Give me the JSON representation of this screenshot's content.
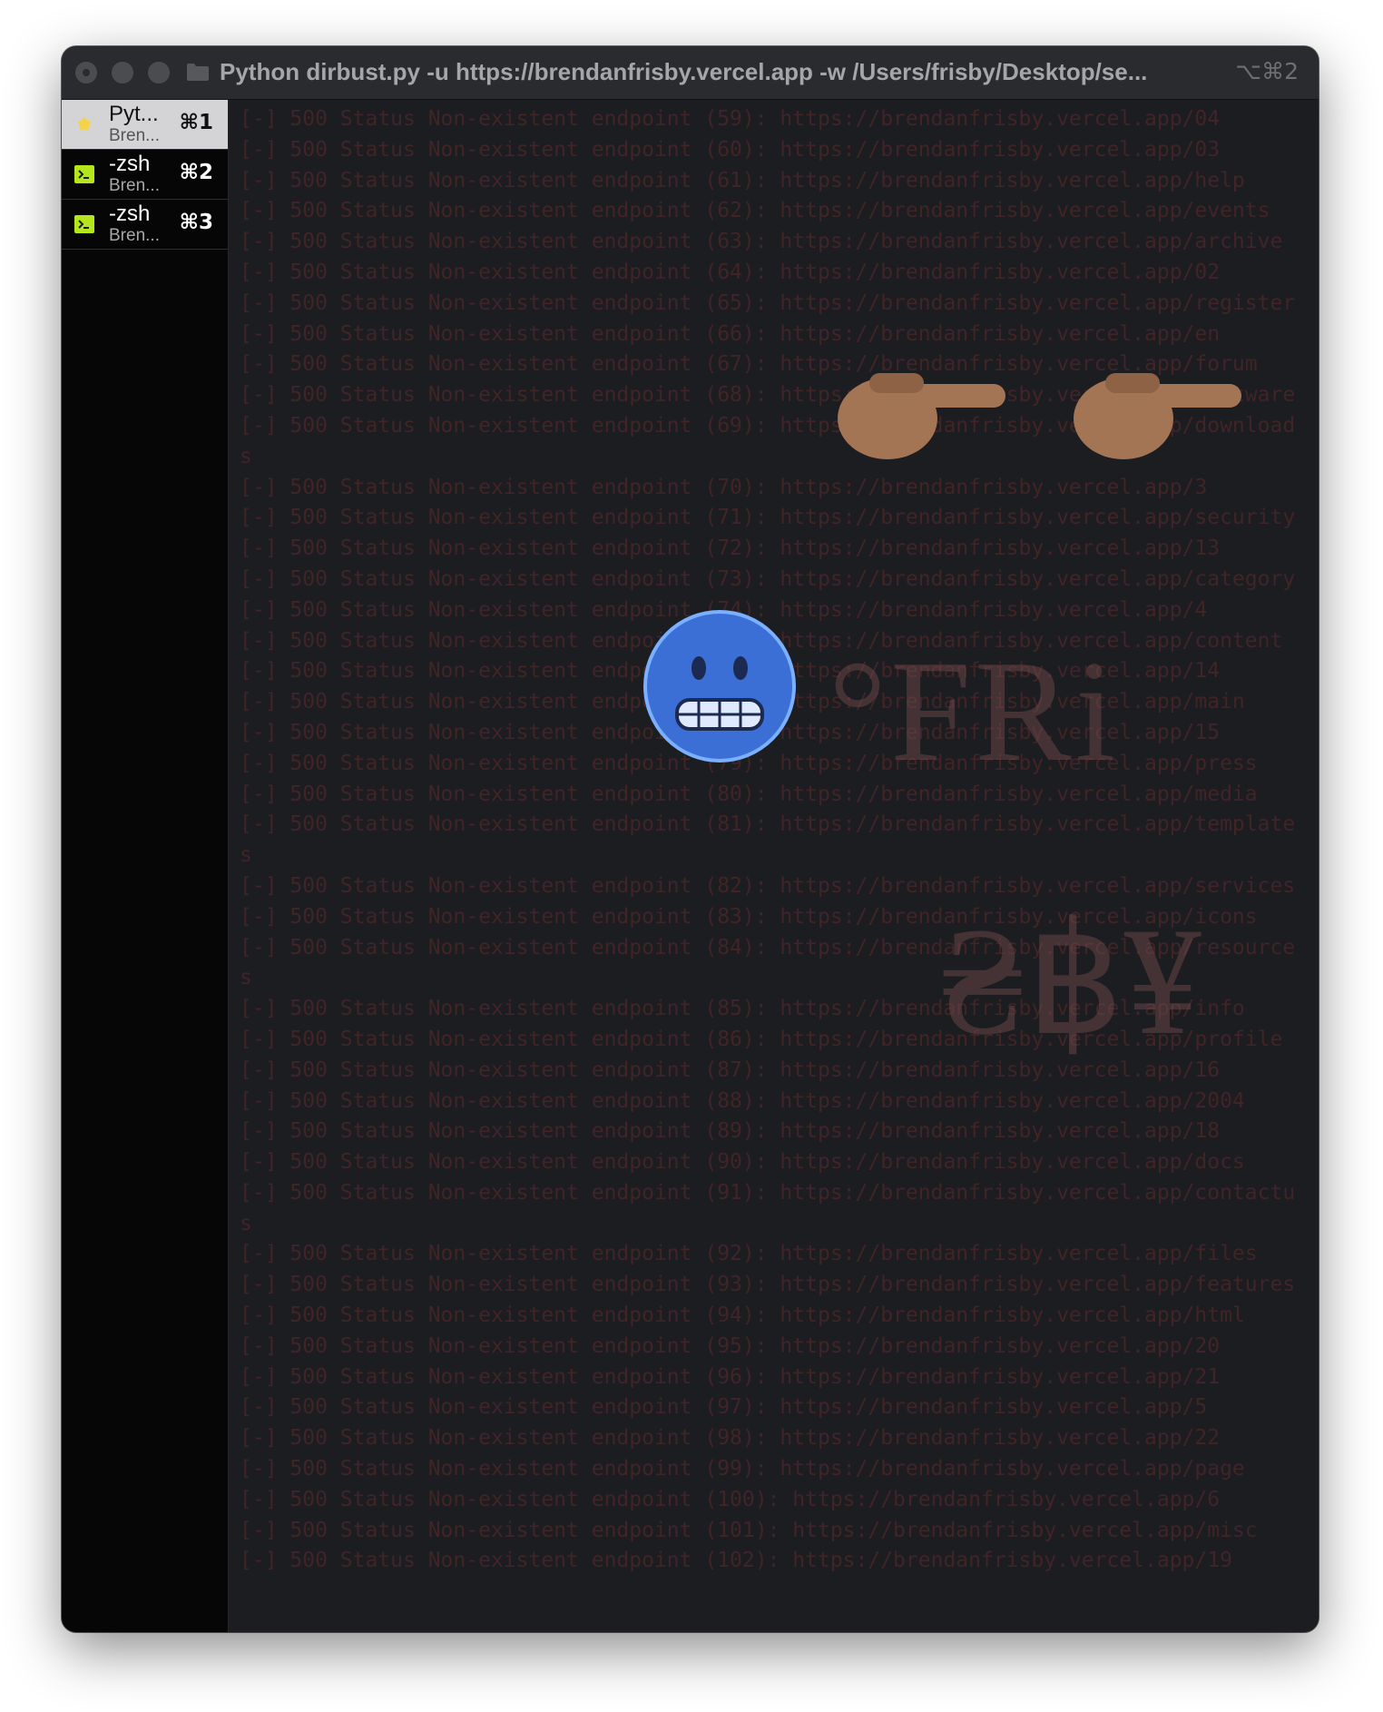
{
  "window": {
    "title": "Python dirbust.py -u https://brendanfrisby.vercel.app -w /Users/frisby/Desktop/se...",
    "shortcut": "⌥⌘2"
  },
  "tabs": [
    {
      "title": "Pyt...",
      "subtitle": "Bren...",
      "key": "⌘1",
      "icon": "python-icon",
      "active": true
    },
    {
      "title": "-zsh",
      "subtitle": "Bren...",
      "key": "⌘2",
      "icon": "terminal-icon",
      "active": false
    },
    {
      "title": "-zsh",
      "subtitle": "Bren...",
      "key": "⌘3",
      "icon": "terminal-icon",
      "active": false
    }
  ],
  "terminal": {
    "lines": [
      "[-] 500 Status Non-existent endpoint (59): https://brendanfrisby.vercel.app/04",
      "[-] 500 Status Non-existent endpoint (60): https://brendanfrisby.vercel.app/03",
      "[-] 500 Status Non-existent endpoint (61): https://brendanfrisby.vercel.app/help",
      "[-] 500 Status Non-existent endpoint (62): https://brendanfrisby.vercel.app/events",
      "[-] 500 Status Non-existent endpoint (63): https://brendanfrisby.vercel.app/archive",
      "[-] 500 Status Non-existent endpoint (64): https://brendanfrisby.vercel.app/02",
      "[-] 500 Status Non-existent endpoint (65): https://brendanfrisby.vercel.app/register",
      "[-] 500 Status Non-existent endpoint (66): https://brendanfrisby.vercel.app/en",
      "[-] 500 Status Non-existent endpoint (67): https://brendanfrisby.vercel.app/forum",
      "[-] 500 Status Non-existent endpoint (68): https://brendanfrisby.vercel.app/software",
      "[-] 500 Status Non-existent endpoint (69): https://brendanfrisby.vercel.app/download",
      "s",
      "[-] 500 Status Non-existent endpoint (70): https://brendanfrisby.vercel.app/3",
      "[-] 500 Status Non-existent endpoint (71): https://brendanfrisby.vercel.app/security",
      "[-] 500 Status Non-existent endpoint (72): https://brendanfrisby.vercel.app/13",
      "[-] 500 Status Non-existent endpoint (73): https://brendanfrisby.vercel.app/category",
      "[-] 500 Status Non-existent endpoint (74): https://brendanfrisby.vercel.app/4",
      "[-] 500 Status Non-existent endpoint (75): https://brendanfrisby.vercel.app/content",
      "[-] 500 Status Non-existent endpoint (76): https://brendanfrisby.vercel.app/14",
      "[-] 500 Status Non-existent endpoint (77): https://brendanfrisby.vercel.app/main",
      "[-] 500 Status Non-existent endpoint (78): https://brendanfrisby.vercel.app/15",
      "[-] 500 Status Non-existent endpoint (79): https://brendanfrisby.vercel.app/press",
      "[-] 500 Status Non-existent endpoint (80): https://brendanfrisby.vercel.app/media",
      "[-] 500 Status Non-existent endpoint (81): https://brendanfrisby.vercel.app/template",
      "s",
      "[-] 500 Status Non-existent endpoint (82): https://brendanfrisby.vercel.app/services",
      "[-] 500 Status Non-existent endpoint (83): https://brendanfrisby.vercel.app/icons",
      "[-] 500 Status Non-existent endpoint (84): https://brendanfrisby.vercel.app/resource",
      "s",
      "[-] 500 Status Non-existent endpoint (85): https://brendanfrisby.vercel.app/info",
      "[-] 500 Status Non-existent endpoint (86): https://brendanfrisby.vercel.app/profile",
      "[-] 500 Status Non-existent endpoint (87): https://brendanfrisby.vercel.app/16",
      "[-] 500 Status Non-existent endpoint (88): https://brendanfrisby.vercel.app/2004",
      "[-] 500 Status Non-existent endpoint (89): https://brendanfrisby.vercel.app/18",
      "[-] 500 Status Non-existent endpoint (90): https://brendanfrisby.vercel.app/docs",
      "[-] 500 Status Non-existent endpoint (91): https://brendanfrisby.vercel.app/contactu",
      "s",
      "[-] 500 Status Non-existent endpoint (92): https://brendanfrisby.vercel.app/files",
      "[-] 500 Status Non-existent endpoint (93): https://brendanfrisby.vercel.app/features",
      "[-] 500 Status Non-existent endpoint (94): https://brendanfrisby.vercel.app/html",
      "[-] 500 Status Non-existent endpoint (95): https://brendanfrisby.vercel.app/20",
      "[-] 500 Status Non-existent endpoint (96): https://brendanfrisby.vercel.app/21",
      "[-] 500 Status Non-existent endpoint (97): https://brendanfrisby.vercel.app/5",
      "[-] 500 Status Non-existent endpoint (98): https://brendanfrisby.vercel.app/22",
      "[-] 500 Status Non-existent endpoint (99): https://brendanfrisby.vercel.app/page",
      "[-] 500 Status Non-existent endpoint (100): https://brendanfrisby.vercel.app/6",
      "[-] 500 Status Non-existent endpoint (101): https://brendanfrisby.vercel.app/misc",
      "[-] 500 Status Non-existent endpoint (102): https://brendanfrisby.vercel.app/19"
    ]
  },
  "overlay": {
    "logo_text": "°FRi",
    "logo_currency": "₴฿¥",
    "emoji": [
      "backhand-index-pointing-right",
      "backhand-index-pointing-right",
      "cold-face"
    ]
  },
  "colors": {
    "terminal_text": "#402426",
    "terminal_bg": "#1c1d21",
    "sidebar_bg": "#060606",
    "active_tab_bg": "#d4d4d6",
    "python_icon": "#f3d34a",
    "terminal_icon": "#b5e61d"
  }
}
